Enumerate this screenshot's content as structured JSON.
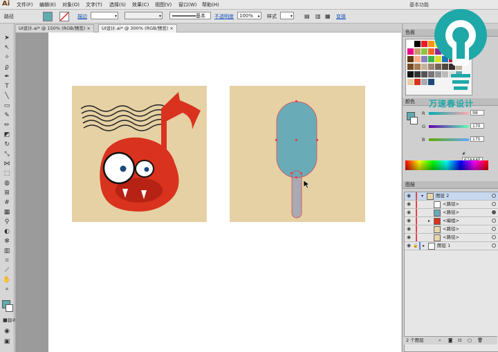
{
  "app": {
    "logo": "Ai",
    "workspace": "基本功能"
  },
  "menu": [
    "文件(F)",
    "编辑(E)",
    "对象(O)",
    "文字(T)",
    "选择(S)",
    "效果(C)",
    "视图(V)",
    "窗口(W)",
    "帮助(H)"
  ],
  "control": {
    "selection_label": "路径",
    "stroke_label": "描边",
    "stroke_style": "基本",
    "opacity_label": "不透明度",
    "opacity_value": "100%",
    "style_label": "样式",
    "transform_label": "变换"
  },
  "tabs": [
    {
      "label": "UI设计.ai* @ 150% (RGB/预览)",
      "active": false
    },
    {
      "label": "UI设计.ai* @ 300% (RGB/预览)",
      "active": true
    }
  ],
  "panels": {
    "swatches_title": "色板",
    "color_title": "颜色",
    "color": {
      "r_label": "R",
      "r_value": "98",
      "g_label": "G",
      "g_value": "170",
      "b_label": "B",
      "b_value": "175",
      "hex_label": "#",
      "hex_value": "62AAAF"
    },
    "layers_title": "图层",
    "layers": [
      {
        "name": "图层 2",
        "level": 0,
        "expanded": true,
        "selected": true
      },
      {
        "name": "<路径>",
        "level": 1
      },
      {
        "name": "<路径>",
        "level": 1
      },
      {
        "name": "<编组>",
        "level": 1,
        "collapsed": true
      },
      {
        "name": "<路径>",
        "level": 1
      },
      {
        "name": "<路径>",
        "level": 1
      },
      {
        "name": "图层 1",
        "level": 0,
        "locked": true,
        "collapsed": true
      }
    ],
    "layers_count": "2 个图层"
  },
  "watermark": {
    "text": "万速春设计"
  },
  "colors": {
    "accent_cyan": "#1fa8a8",
    "artboard_bg": "#e5d1a4",
    "monster_red": "#d9321e",
    "popsicle_blue": "#6aabb8",
    "stick_gray": "#a8aab4",
    "selection_red": "#e0454d"
  }
}
